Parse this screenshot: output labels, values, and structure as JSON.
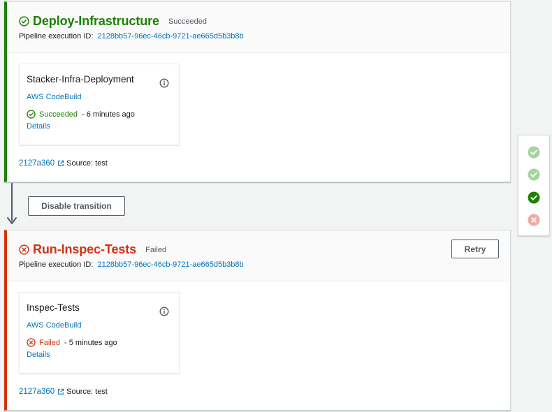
{
  "colors": {
    "success": "#1d8102",
    "failed": "#d13212",
    "link": "#0073bb",
    "history_success_faded": "#a6d3a0",
    "history_failed_faded": "#f0aaa0"
  },
  "stages": [
    {
      "name": "Deploy-Infrastructure",
      "status": "Succeeded",
      "status_icon": "check-circle-icon",
      "execution_label": "Pipeline execution ID:",
      "execution_id": "2128bb57-96ec-46cb-9721-ae665d5b3b8b",
      "action": {
        "name": "Stacker-Infra-Deployment",
        "provider": "AWS CodeBuild",
        "status": "Succeeded",
        "time": "- 6 minutes ago",
        "details": "Details"
      },
      "revision": {
        "id": "2127a360",
        "source": "Source: test"
      }
    },
    {
      "name": "Run-Inspec-Tests",
      "status": "Failed",
      "status_icon": "x-circle-icon",
      "execution_label": "Pipeline execution ID:",
      "execution_id": "2128bb57-96ec-46cb-9721-ae665d5b3b8b",
      "retry_label": "Retry",
      "action": {
        "name": "Inspec-Tests",
        "provider": "AWS CodeBuild",
        "status": "Failed",
        "time": "- 5 minutes ago",
        "details": "Details"
      },
      "revision": {
        "id": "2127a360",
        "source": "Source: test"
      }
    }
  ],
  "transition": {
    "button_label": "Disable transition"
  },
  "history": [
    "success-faded",
    "success-faded",
    "success",
    "failed-faded"
  ]
}
